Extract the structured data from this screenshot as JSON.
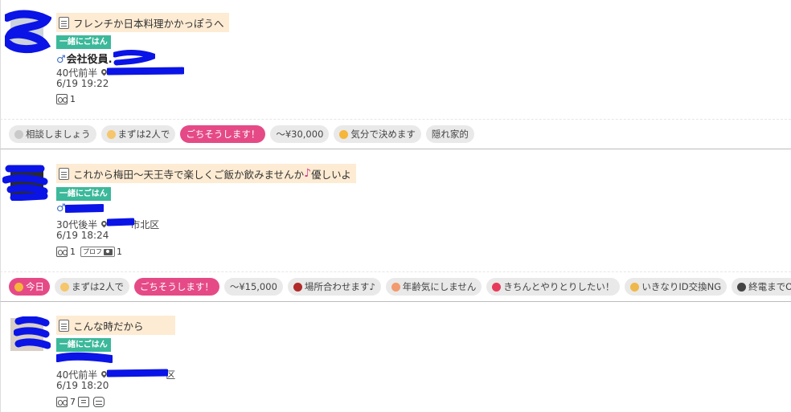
{
  "posts": [
    {
      "title": "フレンチか日本料理かかっぽうへ",
      "title_emphasis": "",
      "title_suffix": "",
      "badge": "一緒にごはん",
      "gender_symbol": "♂",
      "name": "会社役員.",
      "age": "40代前半",
      "location": "",
      "datetime": "6/19 19:22",
      "views": "1",
      "photo_count": ""
    },
    {
      "title": "これから梅田〜天王寺で楽しくご飯か飲みませんか",
      "title_emphasis": "♪",
      "title_suffix": "優しいよ",
      "badge": "一緒にごはん",
      "gender_symbol": "♂",
      "name": "",
      "age": "30代後半",
      "location": "市北区",
      "datetime": "6/19 18:24",
      "views": "1",
      "prof_label": "プロフ",
      "photo_count": "1"
    },
    {
      "title": "こんな時だから",
      "title_emphasis": "",
      "title_suffix": "",
      "badge": "一緒にごはん",
      "gender_symbol": "",
      "name": "",
      "age": "40代前半",
      "location": "区",
      "datetime": "6/19 18:20",
      "views": "7",
      "photo_count": ""
    }
  ],
  "tag_rows": [
    [
      {
        "label": "相談しましょう",
        "style": "gray",
        "icon": "speech-bubble-icon"
      },
      {
        "label": "まずは2人で",
        "style": "gray",
        "icon": "peace-hand-icon"
      },
      {
        "label": "ごちそうします！",
        "style": "pink",
        "icon": ""
      },
      {
        "label": "〜¥30,000",
        "style": "gray",
        "icon": ""
      },
      {
        "label": "気分で決めます",
        "style": "gray",
        "icon": "smile-face-icon"
      },
      {
        "label": "隠れ家的",
        "style": "gray",
        "icon": ""
      }
    ],
    [
      {
        "label": "今日",
        "style": "pink",
        "icon": "smile-face-icon"
      },
      {
        "label": "まずは2人で",
        "style": "gray",
        "icon": "peace-hand-icon"
      },
      {
        "label": "ごちそうします！",
        "style": "pink",
        "icon": ""
      },
      {
        "label": "〜¥15,000",
        "style": "gray",
        "icon": ""
      },
      {
        "label": "場所合わせます♪",
        "style": "gray",
        "icon": "tower-icon"
      },
      {
        "label": "年齢気にしません",
        "style": "gray",
        "icon": "face-icon"
      },
      {
        "label": "きちんとやりとりしたい！",
        "style": "gray",
        "icon": "heart-letter-icon"
      },
      {
        "label": "いきなりID交換NG",
        "style": "gray",
        "icon": "person-icon"
      },
      {
        "label": "終電までOK",
        "style": "gray",
        "icon": "train-icon"
      }
    ]
  ],
  "colors": {
    "accent_pink": "#e54a87",
    "badge_green": "#3cb89a",
    "title_bg": "#fdebd3",
    "tag_gray": "#e9e9e9",
    "redaction_blue": "#0a14e6"
  }
}
